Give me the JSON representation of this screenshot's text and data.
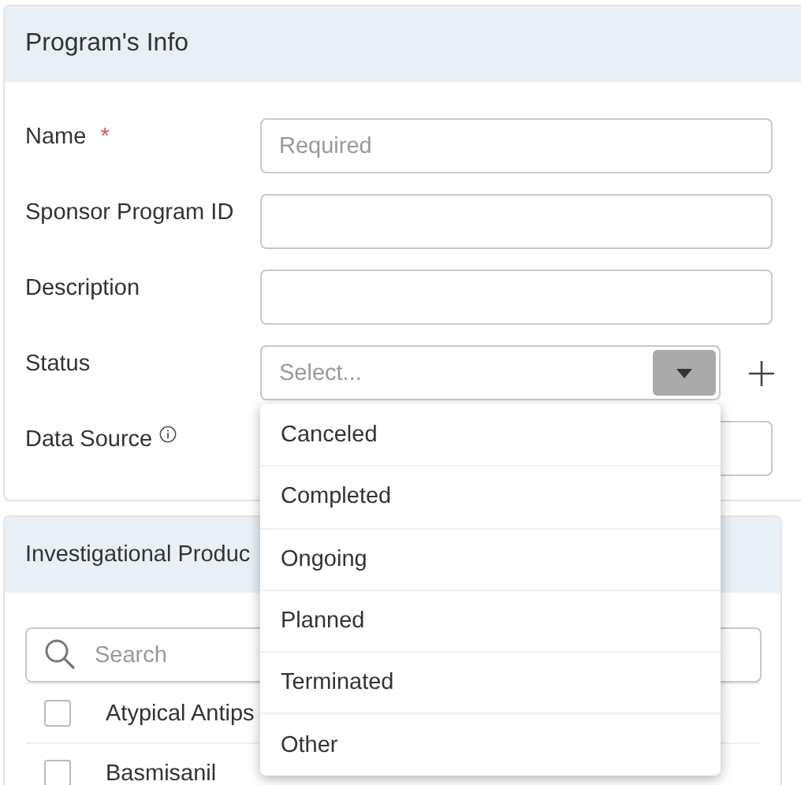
{
  "program_info": {
    "title": "Program's Info",
    "fields": [
      {
        "label": "Name",
        "required_mark": "*",
        "kind": "text",
        "placeholder": "Required"
      },
      {
        "label": "Sponsor Program ID",
        "kind": "text"
      },
      {
        "label": "Description",
        "kind": "text"
      },
      {
        "label": "Status",
        "kind": "select",
        "placeholder": "Select...",
        "expanded": true,
        "options": [
          "Canceled",
          "Completed",
          "Ongoing",
          "Planned",
          "Terminated",
          "Other"
        ]
      },
      {
        "label": "Data Source",
        "kind": "text",
        "info": true
      }
    ]
  },
  "investigational_products": {
    "title": "Investigational Produc",
    "search": {
      "placeholder": "Search"
    },
    "items": [
      {
        "label": "Atypical Antips",
        "checked": false
      },
      {
        "label": "Basmisanil",
        "checked": false
      }
    ]
  }
}
